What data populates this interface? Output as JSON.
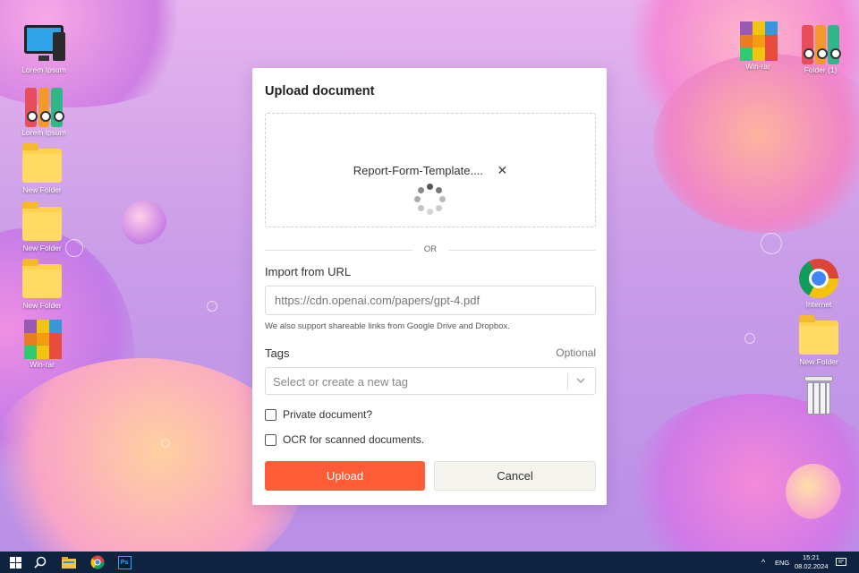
{
  "desktop": {
    "left_icons": [
      {
        "label": "Lorem Ipsum",
        "icon": "computer-icon"
      },
      {
        "label": "Lorem Ipsum",
        "icon": "binders-icon"
      },
      {
        "label": "New Folder",
        "icon": "folder-icon"
      },
      {
        "label": "New Folder",
        "icon": "folder-icon"
      },
      {
        "label": "New Folder",
        "icon": "folder-icon"
      },
      {
        "label": "Win-rar",
        "icon": "winrar-icon"
      }
    ],
    "right_icons": [
      {
        "label": "Win-rar",
        "icon": "winrar-icon"
      },
      {
        "label": "Folder (1)",
        "icon": "binders-icon"
      },
      {
        "label": "Internet",
        "icon": "chrome-icon"
      },
      {
        "label": "New Folder",
        "icon": "folder-icon"
      },
      {
        "label": "",
        "icon": "recycle-bin-icon"
      }
    ]
  },
  "dialog": {
    "title": "Upload document",
    "file_name": "Report-Form-Template....",
    "remove_file_glyph": "✕",
    "or_label": "OR",
    "import_url_label": "Import from URL",
    "url_placeholder": "https://cdn.openai.com/papers/gpt-4.pdf",
    "url_hint": "We also support shareable links from Google Drive and Dropbox.",
    "tags_label": "Tags",
    "tags_optional": "Optional",
    "tags_placeholder": "Select or create a new tag",
    "private_label": "Private document?",
    "ocr_label": "OCR for scanned documents.",
    "upload_button": "Upload",
    "cancel_button": "Cancel"
  },
  "colors": {
    "primary": "#fd5c36",
    "taskbar": "#0d2340"
  },
  "taskbar": {
    "apps": [
      "windows-start-icon",
      "search-icon",
      "file-explorer-icon",
      "chrome-icon",
      "photoshop-icon"
    ],
    "photoshop_label": "Ps",
    "tray_chevron": "^",
    "language": "ENG",
    "time": "15:21",
    "date": "08.02.2024"
  }
}
